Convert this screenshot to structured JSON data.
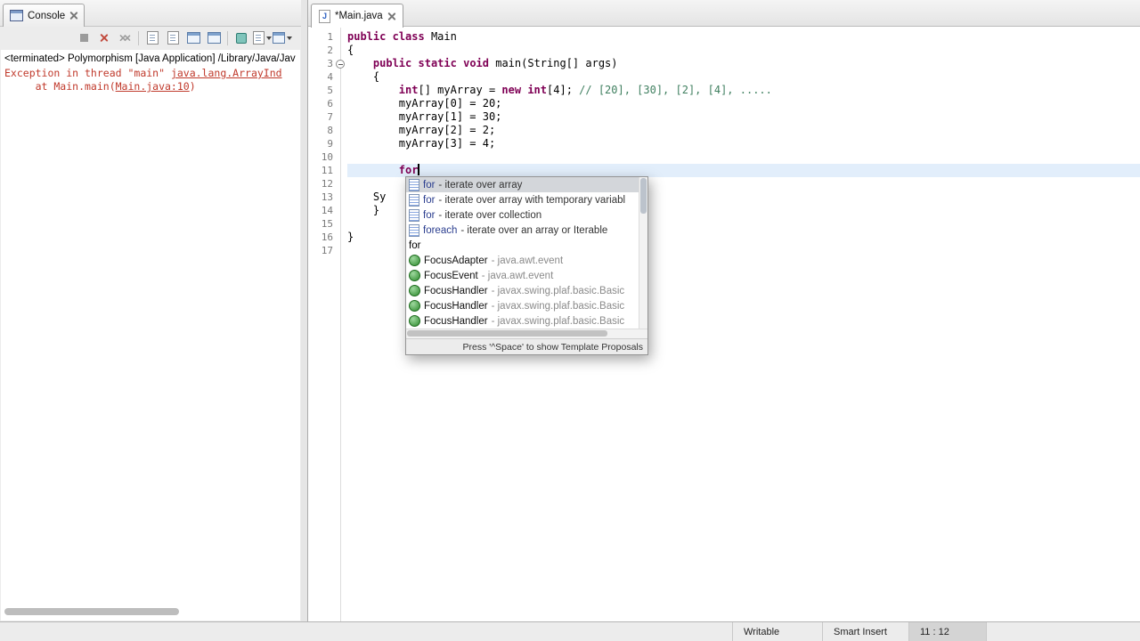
{
  "colors": {
    "keyword": "#7f0055",
    "comment": "#3f7f5f",
    "stderr": "#c0392b",
    "current_line_highlight": "#e2eefb",
    "selected_proposal": "#d3d6da"
  },
  "console": {
    "tab_label": "Console",
    "toolbar_icons": [
      "terminate",
      "remove-launch",
      "remove-all-terminated",
      "clear-console",
      "scroll-lock",
      "show-console-on-stdout",
      "show-console-on-stderr",
      "pin-console",
      "display-selected-console",
      "open-console"
    ],
    "description": "<terminated> Polymorphism [Java Application] /Library/Java/Jav",
    "lines": [
      {
        "segments": [
          {
            "t": "err",
            "x": "Exception in thread \"main\" "
          },
          {
            "t": "link",
            "x": "java.lang.ArrayInd"
          }
        ]
      },
      {
        "segments": [
          {
            "t": "err",
            "x": "     at Main.main("
          },
          {
            "t": "link",
            "x": "Main.java:10"
          },
          {
            "t": "err",
            "x": ")"
          }
        ]
      }
    ]
  },
  "editor": {
    "tab_label": "*Main.java",
    "current_line": 11,
    "lines": [
      {
        "num": 1,
        "segs": [
          {
            "t": "k",
            "x": "public"
          },
          {
            "t": "p",
            "x": " "
          },
          {
            "t": "k",
            "x": "class"
          },
          {
            "t": "p",
            "x": " Main"
          }
        ]
      },
      {
        "num": 2,
        "segs": [
          {
            "t": "p",
            "x": "{"
          }
        ]
      },
      {
        "num": 3,
        "fold": true,
        "segs": [
          {
            "t": "p",
            "x": "    "
          },
          {
            "t": "k",
            "x": "public"
          },
          {
            "t": "p",
            "x": " "
          },
          {
            "t": "k",
            "x": "static"
          },
          {
            "t": "p",
            "x": " "
          },
          {
            "t": "k",
            "x": "void"
          },
          {
            "t": "p",
            "x": " main(String[] args)"
          }
        ]
      },
      {
        "num": 4,
        "segs": [
          {
            "t": "p",
            "x": "    {"
          }
        ]
      },
      {
        "num": 5,
        "segs": [
          {
            "t": "p",
            "x": "        "
          },
          {
            "t": "k",
            "x": "int"
          },
          {
            "t": "p",
            "x": "[] myArray = "
          },
          {
            "t": "k",
            "x": "new"
          },
          {
            "t": "p",
            "x": " "
          },
          {
            "t": "k",
            "x": "int"
          },
          {
            "t": "p",
            "x": "[4]; "
          },
          {
            "t": "c",
            "x": "// [20], [30], [2], [4], ....."
          }
        ]
      },
      {
        "num": 6,
        "segs": [
          {
            "t": "p",
            "x": "        myArray[0] = 20;"
          }
        ]
      },
      {
        "num": 7,
        "segs": [
          {
            "t": "p",
            "x": "        myArray[1] = 30;"
          }
        ]
      },
      {
        "num": 8,
        "segs": [
          {
            "t": "p",
            "x": "        myArray[2] = 2;"
          }
        ]
      },
      {
        "num": 9,
        "segs": [
          {
            "t": "p",
            "x": "        myArray[3] = 4;"
          }
        ]
      },
      {
        "num": 10,
        "segs": []
      },
      {
        "num": 11,
        "cursor": true,
        "segs": [
          {
            "t": "p",
            "x": "        "
          },
          {
            "t": "k",
            "x": "for"
          }
        ]
      },
      {
        "num": 12,
        "segs": []
      },
      {
        "num": 13,
        "segs": [
          {
            "t": "p",
            "x": "    Sy"
          }
        ]
      },
      {
        "num": 14,
        "segs": [
          {
            "t": "p",
            "x": "    }"
          }
        ]
      },
      {
        "num": 15,
        "segs": []
      },
      {
        "num": 16,
        "segs": [
          {
            "t": "p",
            "x": "}"
          }
        ]
      },
      {
        "num": 17,
        "segs": []
      }
    ]
  },
  "popup": {
    "items": [
      {
        "icon": "template",
        "name": "for",
        "desc": " - iterate over array",
        "selected": true
      },
      {
        "icon": "template",
        "name": "for",
        "desc": " - iterate over array with temporary variabl"
      },
      {
        "icon": "template",
        "name": "for",
        "desc": " - iterate over collection"
      },
      {
        "icon": "template",
        "name": "foreach",
        "desc": " - iterate over an array or Iterable"
      },
      {
        "icon": "none",
        "name": "for",
        "desc": ""
      },
      {
        "icon": "class",
        "name": "FocusAdapter",
        "desc": " - java.awt.event"
      },
      {
        "icon": "class",
        "name": "FocusEvent",
        "desc": " - java.awt.event"
      },
      {
        "icon": "class",
        "name": "FocusHandler",
        "desc": " - javax.swing.plaf.basic.Basic"
      },
      {
        "icon": "class",
        "name": "FocusHandler",
        "desc": " - javax.swing.plaf.basic.Basic"
      },
      {
        "icon": "class",
        "name": "FocusHandler",
        "desc": " - javax.swing.plaf.basic.Basic"
      }
    ],
    "footer": "Press '^Space' to show Template Proposals"
  },
  "statusbar": {
    "writable": "Writable",
    "insert_mode": "Smart Insert",
    "position": "11 : 12"
  }
}
